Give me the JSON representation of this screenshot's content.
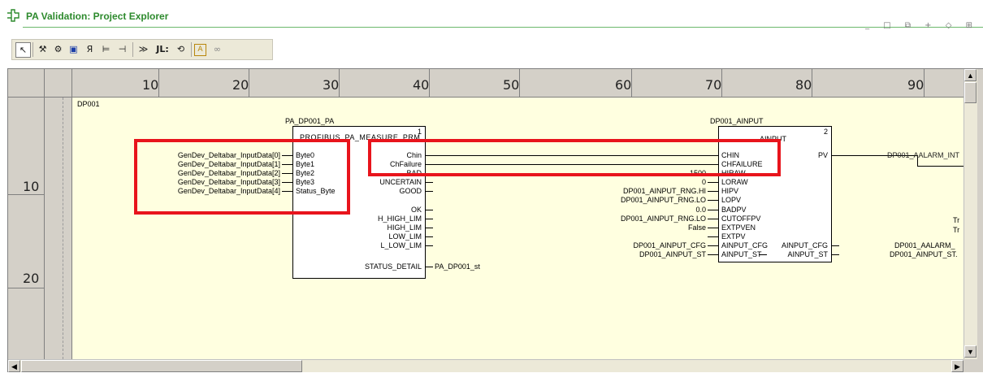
{
  "window": {
    "title": "PA Validation: Project Explorer",
    "title_color": "#2d8a2d",
    "window_controls": "_ □ ⧉ + ◇ ⊞"
  },
  "toolbar": {
    "buttons": [
      {
        "name": "select-icon",
        "glyph": "↖"
      },
      {
        "name": "connect-icon",
        "glyph": "⚒"
      },
      {
        "name": "variable-icon",
        "glyph": "⚙"
      },
      {
        "name": "block-icon",
        "glyph": "▣"
      },
      {
        "name": "sr-icon",
        "glyph": "Я"
      },
      {
        "name": "link-icon",
        "glyph": "⊨"
      },
      {
        "name": "contact-icon",
        "glyph": "⊣"
      },
      {
        "name": "jump-icon",
        "glyph": "≫"
      },
      {
        "name": "label-icon",
        "glyph": "JL:"
      },
      {
        "name": "return-icon",
        "glyph": "⟲"
      },
      {
        "name": "text-icon",
        "glyph": "A"
      },
      {
        "name": "glasses-icon",
        "glyph": "∞"
      }
    ]
  },
  "ruler": {
    "columns": [
      "10",
      "20",
      "30",
      "40",
      "50",
      "60",
      "70",
      "80",
      "90"
    ],
    "rows": [
      "10",
      "20"
    ]
  },
  "section_label": "DP001",
  "block1": {
    "instance": "PA_DP001_PA",
    "type": "PROFIBUS_PA_MEASURE_PRM",
    "number": "1",
    "inputs_external": [
      "GenDev_Deltabar_InputData[0]",
      "GenDev_Deltabar_InputData[1]",
      "GenDev_Deltabar_InputData[2]",
      "GenDev_Deltabar_InputData[3]",
      "GenDev_Deltabar_InputData[4]"
    ],
    "pins_in": [
      "Byte0",
      "Byte1",
      "Byte2",
      "Byte3",
      "Status_Byte"
    ],
    "pins_out": [
      "Chin",
      "ChFailure",
      "BAD",
      "UNCERTAIN",
      "GOOD",
      "OK",
      "H_HIGH_LIM",
      "HIGH_LIM",
      "LOW_LIM",
      "L_LOW_LIM",
      "STATUS_DETAIL"
    ],
    "status_detail_output": "PA_DP001_st"
  },
  "block2": {
    "instance": "DP001_AINPUT",
    "type": "AINPUT",
    "number": "2",
    "pins_in": [
      "CHIN",
      "CHFAILURE",
      "HIRAW",
      "LORAW",
      "HIPV",
      "LOPV",
      "BADPV",
      "CUTOFFPV",
      "EXTPVEN",
      "EXTPV",
      "AINPUT_CFG",
      "AINPUT_ST"
    ],
    "inputs_external": [
      "",
      "",
      "1500",
      "0",
      "DP001_AINPUT_RNG.HI",
      "DP001_AINPUT_RNG.LO",
      "0.0",
      "DP001_AINPUT_RNG.LO",
      "False",
      "",
      "DP001_AINPUT_CFG",
      "DP001_AINPUT_ST"
    ],
    "pins_out": [
      "PV",
      "AINPUT_CFG",
      "AINPUT_ST"
    ]
  },
  "right_side": {
    "pv_target": "DP001_AALARM_INT",
    "labels": [
      "Tr",
      "Tr"
    ],
    "cfg_target": "DP001_AALARM_",
    "st_target": "DP001_AINPUT_ST."
  },
  "highlight_color": "#e8141c"
}
